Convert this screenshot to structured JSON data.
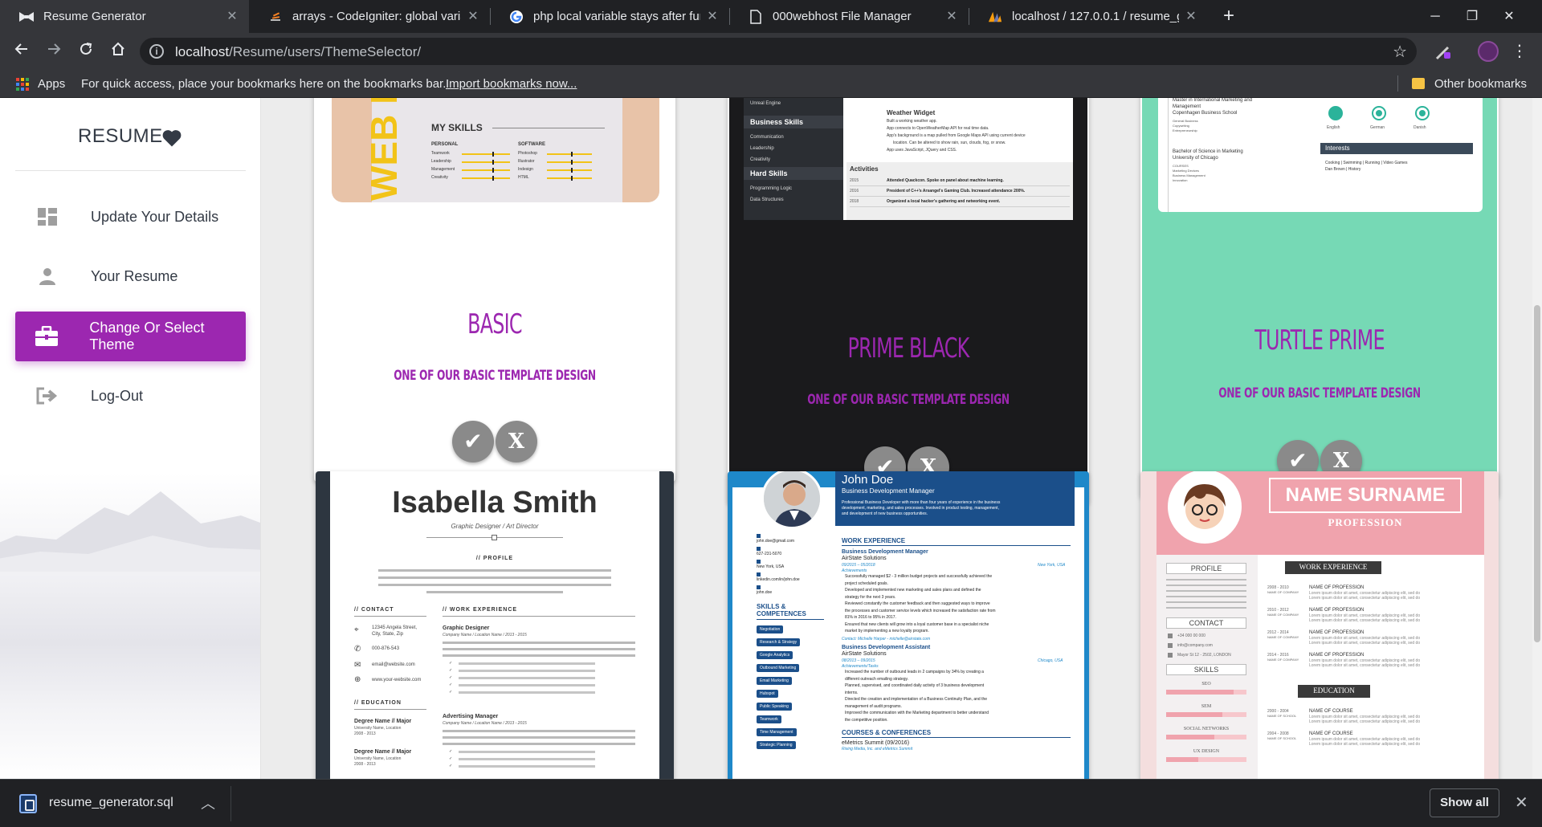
{
  "browser": {
    "tabs": [
      {
        "title": "Resume Generator",
        "active": true
      },
      {
        "title": "arrays - CodeIgniter: global varial"
      },
      {
        "title": "php local variable stays after func"
      },
      {
        "title": "000webhost File Manager"
      },
      {
        "title": "localhost / 127.0.0.1 / resume_ge"
      }
    ],
    "url_host": "localhost",
    "url_path": "/Resume/users/ThemeSelector/",
    "bookmarks": {
      "apps": "Apps",
      "hint": "For quick access, place your bookmarks here on the bookmarks bar.",
      "import_link": "Import bookmarks now...",
      "other": "Other bookmarks"
    }
  },
  "sidebar": {
    "brand": "RESUME",
    "items": [
      {
        "label": "Update Your Details",
        "icon": "dashboard-icon"
      },
      {
        "label": "Your Resume",
        "icon": "user-icon"
      },
      {
        "label": "Change Or Select Theme",
        "icon": "briefcase-icon",
        "active": true
      },
      {
        "label": "Log-Out",
        "icon": "logout-icon"
      }
    ]
  },
  "themes": [
    {
      "name": "BASIC",
      "desc": "ONE OF OUR BASIC TEMPLATE DESIGN",
      "bg": "#ffffff"
    },
    {
      "name": "PRIME BLACK",
      "desc": "ONE OF OUR BASIC TEMPLATE DESIGN",
      "bg": "#1a1a1c"
    },
    {
      "name": "TURTLE PRIME",
      "desc": "ONE OF OUR BASIC TEMPLATE DESIGN",
      "bg": "#76d9b5"
    }
  ],
  "previews": {
    "basic": {
      "heading": "MY SKILLS",
      "personal": "PERSONAL",
      "software": "SOFTWARE",
      "personal_rows": [
        "Teamwork",
        "Leadership",
        "Management",
        "Creativity"
      ],
      "software_rows": [
        "Photoshop",
        "Illustrator",
        "Indesign",
        "HTML"
      ],
      "web": "WEB D"
    },
    "prime": {
      "widget": "Weather Widget",
      "bullets": [
        "Built a working weather app.",
        "App connects to OpenWeatherMap API for real time data.",
        "App's background is a map pulled from Google Maps API using current device",
        "location. Can be altered to show rain, sun, clouds, fog, or snow.",
        "App uses JavaScript, JQuery and CSS."
      ],
      "activities": "Activities",
      "act_rows": [
        {
          "year": "2015",
          "text": "Attended Quackcon. Spoke on panel about machine learning."
        },
        {
          "year": "2016",
          "text": "President of C++'s Arsangel's Gaming Club. Increased attendance 200%."
        },
        {
          "year": "2018",
          "text": "Organized a local hacker's gathering and networking event."
        }
      ],
      "side_top": "Unreal Engine",
      "business_skills": "Business Skills",
      "bs_rows": [
        "Communication",
        "Leadership",
        "Creativity"
      ],
      "hard_skills": "Hard Skills",
      "hs_rows": [
        "Programming Logic",
        "Data Structures"
      ]
    },
    "turtle": {
      "lines": [
        "Master in International Marketing and",
        "Management",
        "Copenhagen Business School"
      ],
      "small": [
        "General Business",
        "Copywriting",
        "Entrepreneurship"
      ],
      "edu": [
        "Bachelor of Science in Marketing",
        "University of Chicago"
      ],
      "small2": [
        "COURSES",
        "Marketing Devices",
        "Business Management",
        "Innovation"
      ],
      "langs": [
        "English",
        "German",
        "Danish"
      ],
      "interests": "Interests",
      "interest_text": [
        "Cooking | Swimming | Running | Video Games",
        "Dan Brown | History"
      ]
    },
    "isabella": {
      "name": "Isabella Smith",
      "role": "Graphic Designer / Art Director",
      "profile": "// PROFILE",
      "contact": "// CONTACT",
      "experience": "// WORK EXPERIENCE",
      "education": "// EDUCATION",
      "address": [
        "12345 Angela Street,",
        "City, State, Zip"
      ],
      "phone": "000-876-543",
      "email": "email@website.com",
      "web": "www.your-website.com",
      "job1": "Graphic Designer",
      "job2": "Advertising Manager",
      "job_meta": "Company Name / Location Name / 2013 - 2015",
      "degree": "Degree Name // Major",
      "degree_meta": [
        "University Name, Location",
        "2008 - 2013"
      ]
    },
    "johndoe": {
      "name": "John Doe",
      "role": "Business Development Manager",
      "summary": [
        "Professional Business Developer with more than four years of experience in the business",
        "development, marketing, and sales processes. Involved in product testing, management,",
        "and development of new business opportunities."
      ],
      "work": "WORK EXPERIENCE",
      "job1": "Business Development Manager",
      "comp1": "AirState Solutions",
      "dates1": "09/2015 – 05/2018",
      "loc1": "New York, USA",
      "achievements": "Achievements",
      "job1_bullets": [
        "Successfully managed $2 - 3 million budget projects and successfully achieved the",
        "project scheduled goals.",
        "Developed and implemented new marketing and sales plans and defined the",
        "strategy for the next 3 years.",
        "Reviewed constantly the customer feedback and then suggested ways to improve",
        "the processes and customer service levels which increased the satisfaction rate from",
        "81% in 2016 to 95% in 2017.",
        "Ensured that new clients will grow into a loyal customer base in a specialist niche",
        "market by implementing a new loyalty program."
      ],
      "contact1": "Contact: Michelle Harper - michelle@airstate.com",
      "job2": "Business Development Assistant",
      "comp2": "AirState Solutions",
      "dates2": "08/2013 – 09/2015",
      "loc2": "Chicago, USA",
      "tasks": "Achievements/Tasks",
      "job2_bullets": [
        "Increased the number of outbound leads in 2 campaigns by 34% by creating a",
        "different outreach emailing strategy.",
        "Planned, supervised, and coordinated daily activity of 3 business development",
        "interns.",
        "Directed the creation and implementation of a Business Continuity Plan, and the",
        "management of audit programs.",
        "Improved the communication with the Marketing department to better understand",
        "the competitive position."
      ],
      "courses": "COURSES & CONFERENCES",
      "course1": "eMetrics Summit (09/2016)",
      "course1_meta": "Rising Media, Inc. and eMetrics Summit",
      "email": "john.doe@gmail.com",
      "phone": "627-231-5070",
      "city": "New York, USA",
      "linkedin": "linkedin.com/in/john.doe",
      "handle": "john.doe",
      "skills_title": [
        "SKILLS &",
        "COMPETENCES"
      ],
      "skills": [
        "Negotiation",
        "Research & Strategy",
        "Google Analytics",
        "Outbound Marketing",
        "Email Marketing",
        "Hubspot",
        "Public Speaking",
        "Teamwork",
        "Time Management",
        "Strategic Planning"
      ]
    },
    "namesurname": {
      "name": "NAME SURNAME",
      "profession": "PROFESSION",
      "profile": "PROFILE",
      "contact": "CONTACT",
      "skills": "SKILLS",
      "skill_labels": [
        "SEO",
        "SEM",
        "SOCIAL NETWORKS",
        "UX DESIGN"
      ],
      "contact_rows": [
        "+34 000 00 000",
        "info@company.com",
        "Mayor St 12 - 2502, LONDON"
      ],
      "work": "WORK EXPERIENCE",
      "education": "EDUCATION",
      "jobs": [
        {
          "years": "2008 - 2010",
          "place": "NAME OF COMPANY",
          "title": "NAME OF PROFESSION"
        },
        {
          "years": "2010 - 2012",
          "place": "NAME OF COMPANY",
          "title": "NAME OF PROFESSION"
        },
        {
          "years": "2012 - 2014",
          "place": "NAME OF COMPANY",
          "title": "NAME OF PROFESSION"
        },
        {
          "years": "2014 - 2016",
          "place": "NAME OF COMPANY",
          "title": "NAME OF PROFESSION"
        }
      ],
      "edus": [
        {
          "years": "2000 - 2004",
          "place": "NAME OF SCHOOL",
          "title": "NAME OF COURSE"
        },
        {
          "years": "2004 - 2008",
          "place": "NAME OF SCHOOL",
          "title": "NAME OF COURSE"
        }
      ],
      "lorem": "Lorem ipsum dolor sit amet, consectetur adipiscing elit, sed do"
    }
  },
  "downloads": {
    "file": "resume_generator.sql",
    "show_all": "Show all"
  },
  "colors": {
    "accent": "#9c27b0",
    "turtle_bg": "#76d9b5",
    "prime_bg": "#1a1a1c",
    "pink": "#f0a3ad"
  }
}
